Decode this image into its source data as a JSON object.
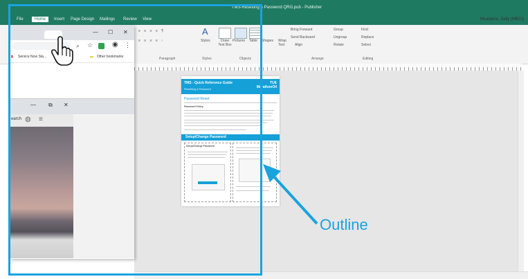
{
  "window": {
    "title": "TMS-Resetting a Password QRG.pub - Publisher",
    "user": "Mcadams, Sally (MBCI)"
  },
  "ribbon": {
    "tabs": [
      "File",
      "Home",
      "Insert",
      "Page Design",
      "Mailings",
      "Review",
      "View"
    ],
    "active_tab": "Home",
    "groups": {
      "paragraph": "Paragraph",
      "styles": "Styles",
      "objects": "Objects",
      "arrange": "Arrange",
      "editing": "Editing"
    },
    "buttons": {
      "styles": "Styles",
      "draw_text_box": "Draw Text Box",
      "pictures": "Pictures",
      "table": "Table",
      "shapes": "Shapes",
      "wrap_text": "Wrap Text",
      "bring_forward": "Bring Forward",
      "send_backward": "Send Backward",
      "align": "Align",
      "group": "Group",
      "ungroup": "Ungroup",
      "rotate": "Rotate",
      "find": "Find",
      "replace": "Replace",
      "select": "Select"
    }
  },
  "browser": {
    "bookmark_item": "Service Now Sta...",
    "other_bookmarks": "Other bookmarks",
    "inner_tab_text": "earch"
  },
  "document": {
    "title": "TMS - Quick Reference Guide",
    "subtitle": "Resetting a Password",
    "logo_line1": "TUE",
    "logo_line2": "MarathonOil",
    "section1": "Password Reset",
    "para_title": "Password Policy",
    "section2": "Setup/Change Password",
    "step_title": "Setup/Change Password"
  },
  "callout": {
    "label": "Outline"
  },
  "colors": {
    "accent": "#19a3df",
    "publisher_green": "#1f7a62",
    "doc_blue": "#16a0d8"
  }
}
